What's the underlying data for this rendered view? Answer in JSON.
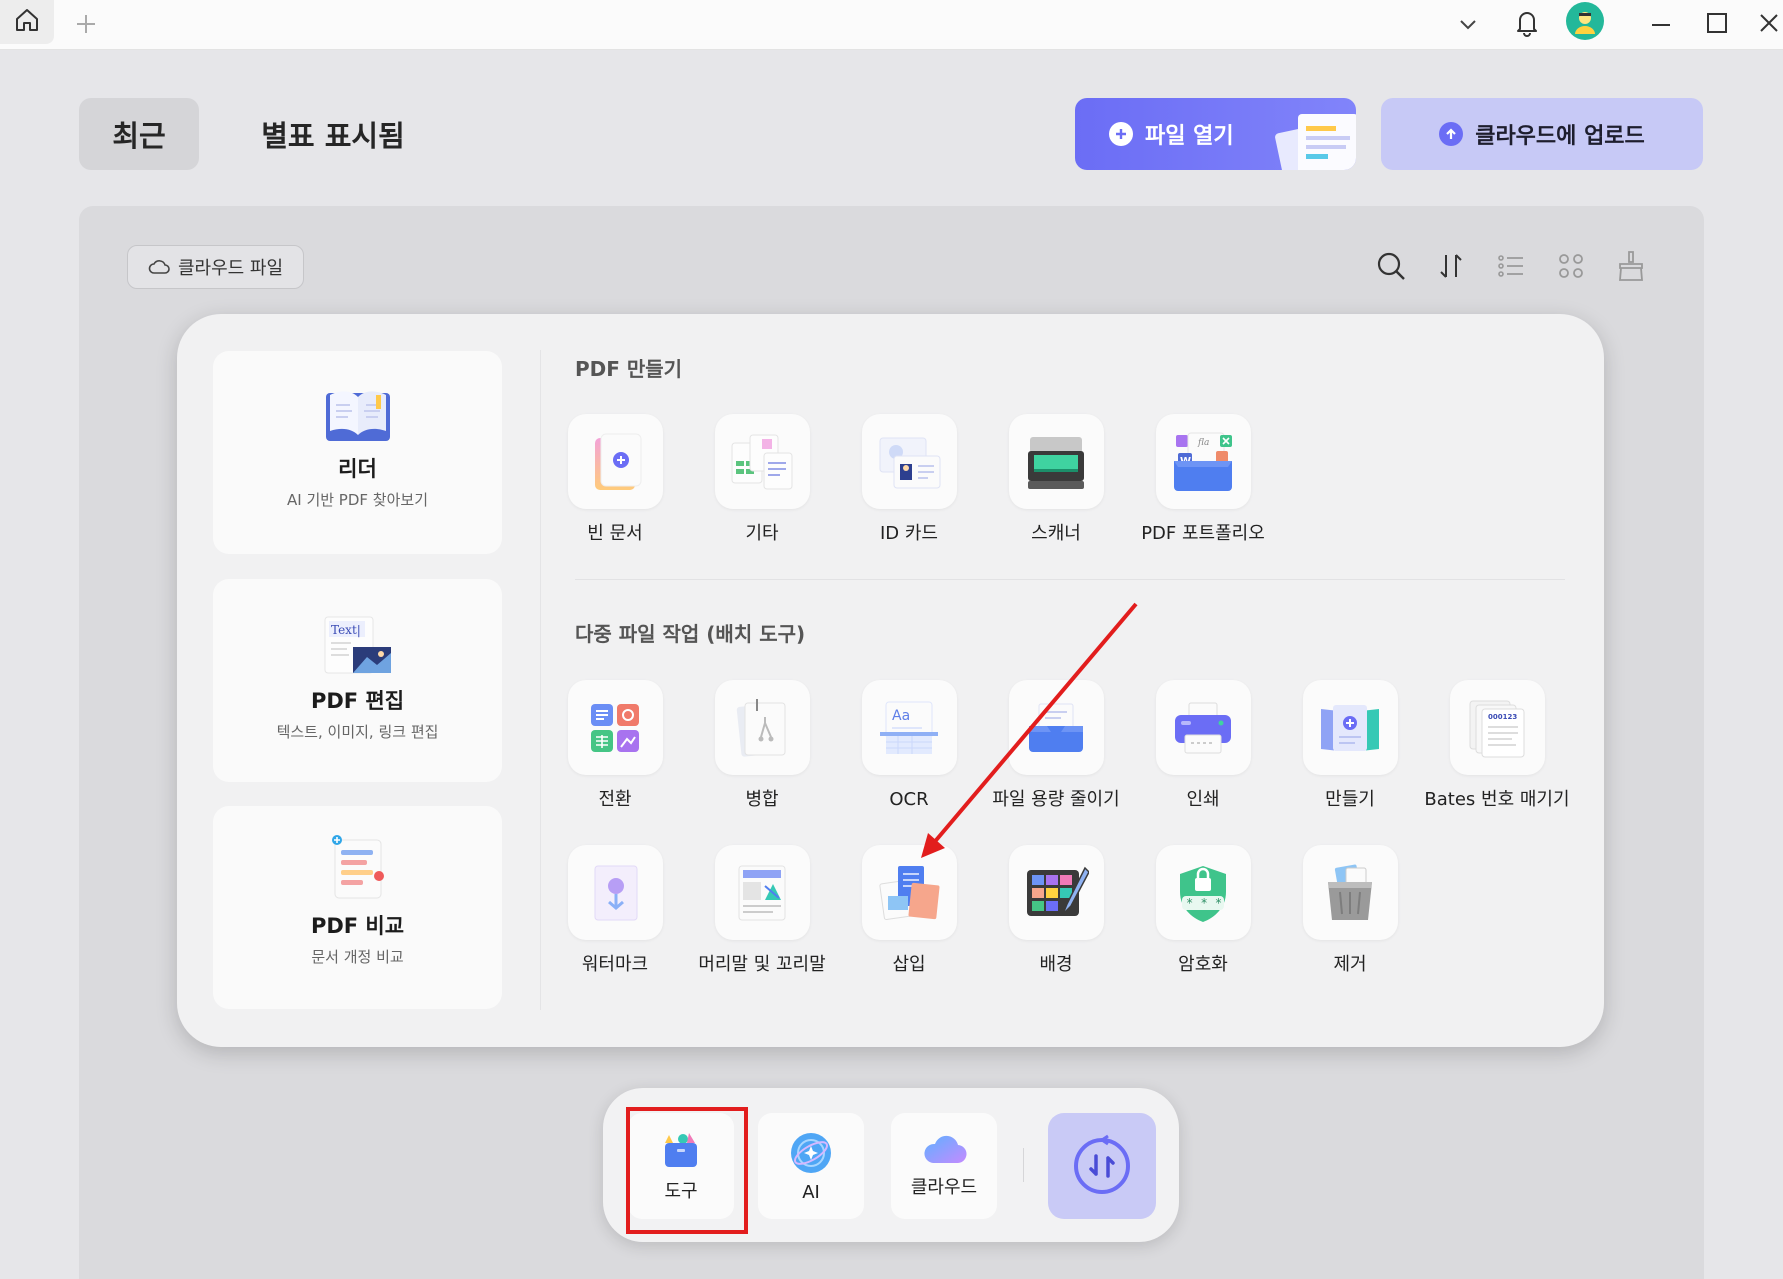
{
  "titlebar": {
    "icons": [
      "home-icon",
      "plus-icon",
      "chevron-down-icon",
      "bell-icon",
      "avatar",
      "minimize-icon",
      "maximize-icon",
      "close-icon"
    ]
  },
  "header": {
    "tab_recent": "최근",
    "tab_starred": "별표 표시됨",
    "open_file": "파일 열기",
    "upload_cloud": "클라우드에 업로드"
  },
  "toolbar": {
    "cloud_files": "클라우드 파일",
    "icons": [
      "search-icon",
      "sort-icon",
      "list-view-icon",
      "grid-view-icon",
      "clean-icon"
    ]
  },
  "side_cards": [
    {
      "title": "리더",
      "subtitle": "AI 기반 PDF 찾아보기"
    },
    {
      "title": "PDF 편집",
      "subtitle": "텍스트, 이미지, 링크 편집",
      "badge": "Text|"
    },
    {
      "title": "PDF 비교",
      "subtitle": "문서 개정 비교"
    }
  ],
  "create_section": {
    "title": "PDF 만들기",
    "items": [
      "빈 문서",
      "기타",
      "ID 카드",
      "스캐너",
      "PDF 포트폴리오"
    ]
  },
  "batch_section": {
    "title": "다중 파일 작업 (배치 도구)",
    "row1": [
      "전환",
      "병합",
      "OCR",
      "파일 용량 줄이기",
      "인쇄",
      "만들기",
      "Bates 번호 매기기"
    ],
    "row2": [
      "워터마크",
      "머리말 및 꼬리말",
      "삽입",
      "배경",
      "암호화",
      "제거"
    ],
    "ocr_glyph": "Aa",
    "bates_glyph": "000123"
  },
  "dock": {
    "tools": "도구",
    "ai": "AI",
    "cloud": "클라우드"
  },
  "colors": {
    "accent": "#6b6df5",
    "highlight": "#e21d1d"
  }
}
